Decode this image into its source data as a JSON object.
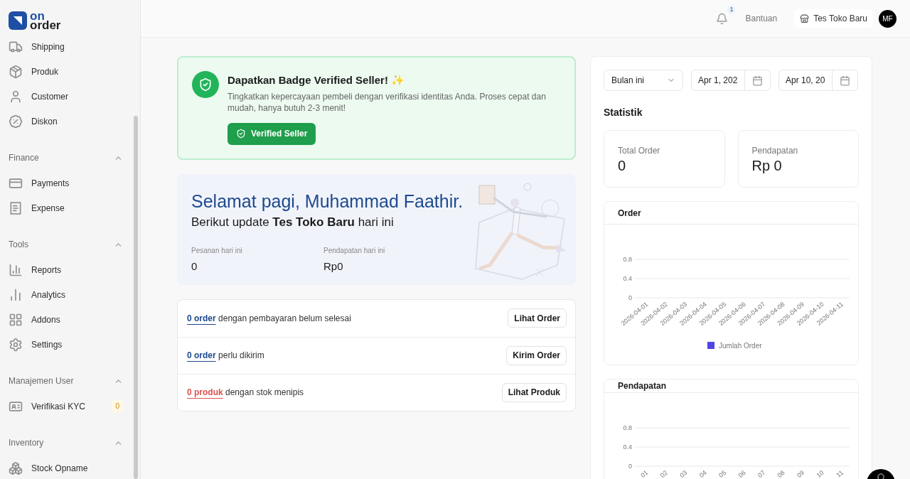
{
  "logo": {
    "line1": "on",
    "line2": "order"
  },
  "sidebar": {
    "sections": [
      {
        "items": [
          {
            "label": "Shipping"
          },
          {
            "label": "Produk"
          },
          {
            "label": "Customer"
          },
          {
            "label": "Diskon"
          }
        ]
      },
      {
        "title": "Finance",
        "expanded": true,
        "items": [
          {
            "label": "Payments"
          },
          {
            "label": "Expense"
          }
        ]
      },
      {
        "title": "Tools",
        "expanded": true,
        "items": [
          {
            "label": "Reports"
          },
          {
            "label": "Analytics"
          },
          {
            "label": "Addons"
          },
          {
            "label": "Settings"
          }
        ]
      },
      {
        "title": "Manajemen User",
        "expanded": true,
        "items": [
          {
            "label": "Verifikasi KYC",
            "badge": "0"
          }
        ]
      },
      {
        "title": "Inventory",
        "expanded": true,
        "items": [
          {
            "label": "Stock Opname"
          }
        ]
      }
    ]
  },
  "header": {
    "notification_count": "1",
    "help": "Bantuan",
    "store": "Tes Toko Baru",
    "avatar": "MF"
  },
  "verify_banner": {
    "title": "Dapatkan Badge Verified Seller! ✨",
    "text": "Tingkatkan kepercayaan pembeli dengan verifikasi identitas Anda. Proses cepat dan mudah, hanya butuh 2-3 menit!",
    "button": "Verified Seller"
  },
  "welcome": {
    "greeting": "Selamat pagi, Muhammad Faathir.",
    "subtitle": "Berikut update **Tes Toko Baru** hari ini",
    "stats": [
      {
        "label": "Pesanan hari ini",
        "value": "0"
      },
      {
        "label": "Pendapatan hari ini",
        "value": "Rp0"
      }
    ]
  },
  "tasks": [
    {
      "count": "0 order",
      "kind": "info",
      "text": "dengan pembayaran belum selesai",
      "button": "Lihat Order"
    },
    {
      "count": "0 order",
      "kind": "info",
      "text": "perlu dikirim",
      "button": "Kirim Order"
    },
    {
      "count": "0 produk",
      "kind": "warning",
      "text": "dengan stok menipis",
      "button": "Lihat Produk"
    }
  ],
  "filters": {
    "period": "Bulan ini",
    "start": "Apr 1, 202",
    "end": "Apr 10, 20"
  },
  "stats_title": "Statistik",
  "stat_cards": [
    {
      "label": "Total Order",
      "value": "0"
    },
    {
      "label": "Pendapatan",
      "value": "Rp 0"
    }
  ],
  "charts": [
    {
      "title": "Order",
      "chart_data": {
        "type": "bar",
        "categories": [
          "2026-04-01",
          "2026-04-02",
          "2026-04-03",
          "2026-04-04",
          "2026-04-05",
          "2026-04-06",
          "2026-04-07",
          "2026-04-08",
          "2026-04-09",
          "2026-04-10",
          "2026-04-11"
        ],
        "series": [
          {
            "name": "Jumlah Order",
            "color": "#4f46e5",
            "values": [
              0,
              0,
              0,
              0,
              0,
              0,
              0,
              0,
              0,
              0,
              0
            ]
          }
        ],
        "ylim": [
          0,
          0.8
        ],
        "yticks": [
          0,
          0.4,
          0.8
        ]
      }
    },
    {
      "title": "Pendapatan",
      "chart_data": {
        "type": "bar",
        "categories": [
          "01",
          "02",
          "03",
          "04",
          "05",
          "06",
          "07",
          "08",
          "09",
          "10",
          "11"
        ],
        "series": [
          {
            "color": "#4f46e5",
            "values": [
              0,
              0,
              0,
              0,
              0,
              0,
              0,
              0,
              0,
              0,
              0
            ]
          }
        ],
        "ylim": [
          0,
          0.8
        ],
        "yticks": [
          0,
          0.4,
          0.8
        ]
      }
    }
  ]
}
